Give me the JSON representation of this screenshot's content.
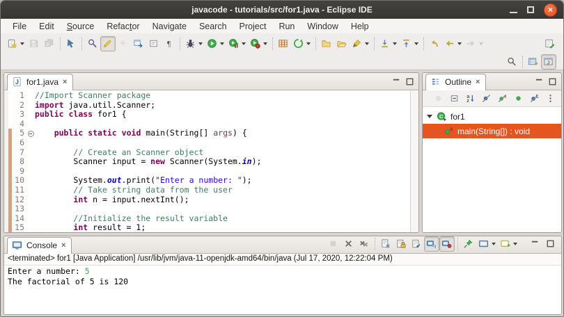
{
  "window": {
    "title": "javacode - tutorials/src/for1.java - Eclipse IDE",
    "controls": {
      "close_glyph": "×"
    }
  },
  "menu": {
    "items": [
      {
        "label": "File"
      },
      {
        "label": "Edit"
      },
      {
        "label": "Source",
        "u": 0
      },
      {
        "label": "Refactor",
        "u": 5
      },
      {
        "label": "Navigate"
      },
      {
        "label": "Search"
      },
      {
        "label": "Project"
      },
      {
        "label": "Run"
      },
      {
        "label": "Window"
      },
      {
        "label": "Help"
      }
    ]
  },
  "toolbar": {
    "main": [
      {
        "name": "new",
        "dd": true
      },
      {
        "name": "save",
        "disabled": true
      },
      {
        "name": "save-all",
        "disabled": true
      },
      {
        "sep": true
      },
      {
        "name": "link-with-editor"
      },
      {
        "sep": true
      },
      {
        "name": "search"
      },
      {
        "name": "mark-occurrences",
        "toggled": true
      },
      {
        "name": "sparkle",
        "disabled": true
      },
      {
        "name": "open-type"
      },
      {
        "name": "block-selection"
      },
      {
        "name": "show-whitespace"
      },
      {
        "sep": true
      },
      {
        "name": "debug",
        "dd": true
      },
      {
        "name": "run",
        "dd": true
      },
      {
        "name": "coverage",
        "dd": true
      },
      {
        "name": "profile",
        "dd": true
      },
      {
        "sep": true
      },
      {
        "name": "table-grid"
      },
      {
        "name": "update-refresh",
        "dd": true
      },
      {
        "sep": true
      },
      {
        "name": "open-folder"
      },
      {
        "name": "open-folder-alt"
      },
      {
        "name": "format-brush",
        "dd": true
      },
      {
        "sep": true
      },
      {
        "name": "next-annotation",
        "dd": true
      },
      {
        "name": "previous-annotation",
        "dd": true
      },
      {
        "sep": true
      },
      {
        "name": "last-edit-location"
      },
      {
        "name": "back",
        "dd": true
      },
      {
        "name": "forward",
        "dd": true,
        "disabled": true
      }
    ],
    "main_right": [
      {
        "name": "new-editor-window"
      }
    ],
    "secondary_right": [
      {
        "name": "search-quick"
      },
      {
        "sep": true
      },
      {
        "name": "open-perspective"
      },
      {
        "name": "java-perspective",
        "toggled": true
      }
    ]
  },
  "editor": {
    "tab": {
      "label": "for1.java",
      "close": "×"
    },
    "code": {
      "lines": [
        {
          "n": 1,
          "seg": [
            [
              "cmt",
              "//Import Scanner package"
            ]
          ]
        },
        {
          "n": 2,
          "seg": [
            [
              "kw",
              "import"
            ],
            [
              "plain",
              " java.util.Scanner;"
            ]
          ]
        },
        {
          "n": 3,
          "seg": [
            [
              "kw",
              "public"
            ],
            [
              "plain",
              " "
            ],
            [
              "kw",
              "class"
            ],
            [
              "plain",
              " for1 {"
            ]
          ]
        },
        {
          "n": 4,
          "seg": []
        },
        {
          "n": 5,
          "fold": true,
          "diff": true,
          "seg": [
            [
              "plain",
              "    "
            ],
            [
              "kw",
              "public"
            ],
            [
              "plain",
              " "
            ],
            [
              "kw",
              "static"
            ],
            [
              "plain",
              " "
            ],
            [
              "kw",
              "void"
            ],
            [
              "plain",
              " main(String[] "
            ],
            [
              "param",
              "args"
            ],
            [
              "plain",
              ") {"
            ]
          ]
        },
        {
          "n": 6,
          "diff": true,
          "seg": []
        },
        {
          "n": 7,
          "diff": true,
          "seg": [
            [
              "plain",
              "        "
            ],
            [
              "cmt",
              "// Create an Scanner object"
            ]
          ]
        },
        {
          "n": 8,
          "diff": true,
          "seg": [
            [
              "plain",
              "        Scanner input = "
            ],
            [
              "kw",
              "new"
            ],
            [
              "plain",
              " Scanner(System."
            ],
            [
              "sfield",
              "in"
            ],
            [
              "plain",
              ");"
            ]
          ]
        },
        {
          "n": 9,
          "diff": true,
          "seg": []
        },
        {
          "n": 10,
          "diff": true,
          "seg": [
            [
              "plain",
              "        System."
            ],
            [
              "sfield",
              "out"
            ],
            [
              "plain",
              ".print("
            ],
            [
              "str",
              "\"Enter a number: \""
            ],
            [
              "plain",
              ");"
            ]
          ]
        },
        {
          "n": 11,
          "diff": true,
          "seg": [
            [
              "plain",
              "        "
            ],
            [
              "cmt",
              "// Take string data from the user"
            ]
          ]
        },
        {
          "n": 12,
          "diff": true,
          "seg": [
            [
              "plain",
              "        "
            ],
            [
              "kw",
              "int"
            ],
            [
              "plain",
              " n = input.nextInt();"
            ]
          ]
        },
        {
          "n": 13,
          "diff": true,
          "seg": []
        },
        {
          "n": 14,
          "diff": true,
          "seg": [
            [
              "plain",
              "        "
            ],
            [
              "cmt",
              "//Initialize the result variable"
            ]
          ]
        },
        {
          "n": 15,
          "diff": true,
          "seg": [
            [
              "plain",
              "        "
            ],
            [
              "kw",
              "int"
            ],
            [
              "plain",
              " result = 1;"
            ]
          ]
        }
      ]
    }
  },
  "outline": {
    "tab": {
      "label": "Outline",
      "close": "×"
    },
    "toolbar": [
      {
        "name": "focus",
        "disabled": true
      },
      {
        "name": "collapse-all"
      },
      {
        "name": "sort"
      },
      {
        "name": "hide-fields"
      },
      {
        "name": "hide-static-members"
      },
      {
        "name": "hide-non-public"
      },
      {
        "name": "hide-local-types"
      },
      {
        "name": "view-menu"
      }
    ],
    "tree": [
      {
        "icon": "class",
        "label": "for1",
        "expanded": true,
        "level": 0,
        "selected": false
      },
      {
        "icon": "method-static",
        "label": "main(String[]) : void",
        "level": 1,
        "selected": true
      }
    ]
  },
  "console": {
    "tab": {
      "label": "Console",
      "close": "×"
    },
    "toolbar": [
      {
        "name": "terminate",
        "disabled": true
      },
      {
        "name": "remove-launch"
      },
      {
        "name": "remove-all-launches"
      },
      {
        "sep": true
      },
      {
        "name": "clear-console"
      },
      {
        "name": "scroll-lock"
      },
      {
        "name": "word-wrap"
      },
      {
        "name": "show-on-stdout",
        "toggled": true
      },
      {
        "name": "show-on-stderr",
        "toggled": true
      },
      {
        "sep": true
      },
      {
        "name": "pin-console"
      },
      {
        "name": "display-console",
        "dd": true
      },
      {
        "name": "open-console",
        "dd": true
      },
      {
        "gap": true
      },
      {
        "name": "minimize-panel"
      },
      {
        "name": "maximize-panel"
      }
    ],
    "status": "<terminated> for1 [Java Application] /usr/lib/jvm/java-11-openjdk-amd64/bin/java (Jul 17, 2020, 12:22:04 PM)",
    "output": [
      [
        [
          "plain",
          "Enter a number: "
        ],
        [
          "stdin",
          "5"
        ]
      ],
      [
        [
          "plain",
          "The factorial of 5 is 120"
        ]
      ]
    ]
  },
  "colors": {
    "accent": "#e4551f",
    "kw": "#7f0055",
    "comment": "#3f7f5f",
    "string": "#2a00ff",
    "staticField": "#0000c0",
    "param": "#6a3e3e",
    "stdin": "#3fae49",
    "diff": "#d5a084"
  }
}
